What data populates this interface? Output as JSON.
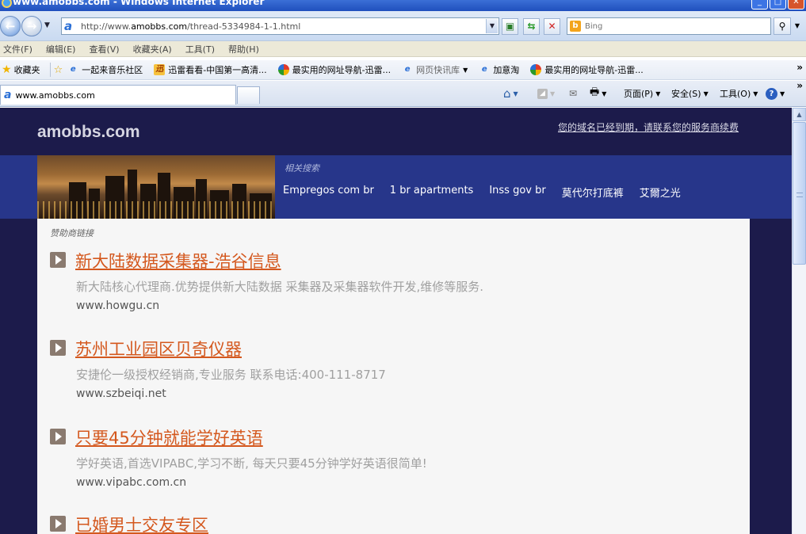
{
  "window": {
    "title": "www.amobbs.com - Windows Internet Explorer"
  },
  "nav": {
    "url_prefix": "http://www.",
    "url_domain": "amobbs.com",
    "url_path": "/thread-5334984-1-1.html",
    "search_placeholder": "Bing"
  },
  "menu": [
    "文件(F)",
    "编辑(E)",
    "查看(V)",
    "收藏夹(A)",
    "工具(T)",
    "帮助(H)"
  ],
  "favorites": {
    "label": "收藏夹",
    "items": [
      {
        "label": "一起来音乐社区",
        "icon": "ie-page-icon"
      },
      {
        "label": "迅雷看看-中国第一高清...",
        "icon": "xunlei-icon"
      },
      {
        "label": "最实用的网址导航-迅雷...",
        "icon": "dh-icon"
      },
      {
        "label": "网页快讯库",
        "icon": "ie-page-icon"
      },
      {
        "label": "加意淘",
        "icon": "ie-page-icon"
      },
      {
        "label": "最实用的网址导航-迅雷...",
        "icon": "dh-icon"
      }
    ]
  },
  "tabs": {
    "active": "www.amobbs.com"
  },
  "commands": {
    "page": "页面(P)",
    "safety": "安全(S)",
    "tools": "工具(O)"
  },
  "page": {
    "site_name": "amobbs.com",
    "expired_notice": "您的域名已经到期，请联系您的服务商续费",
    "related_caption": "相关搜索",
    "related_links": [
      "Empregos com br",
      "1 br apartments",
      "Inss gov br",
      "莫代尔打底裤",
      "艾爾之光"
    ],
    "sponsor_label": "赞助商链接",
    "ads": [
      {
        "title": "新大陆数据采集器-浩谷信息",
        "desc": "新大陆核心代理商.优势提供新大陆数据  采集器及采集器软件开发,维修等服务.",
        "url": "www.howgu.cn"
      },
      {
        "title": "苏州工业园区贝奇仪器",
        "desc": "安捷伦一级授权经销商,专业服务  联系电话:400-111-8717",
        "url": "www.szbeiqi.net"
      },
      {
        "title": "只要45分钟就能学好英语",
        "desc": "学好英语,首选VIPABC,学习不断, 每天只要45分钟学好英语很简单!",
        "url": "www.vipabc.com.cn"
      },
      {
        "title": "已婚男士交友专区",
        "desc": "",
        "url": ""
      }
    ]
  },
  "colors": {
    "page_bg": "#1c1b4b",
    "banner_bg": "#27368a",
    "ad_title": "#d4581e",
    "ad_panel": "#f6f6f6"
  }
}
